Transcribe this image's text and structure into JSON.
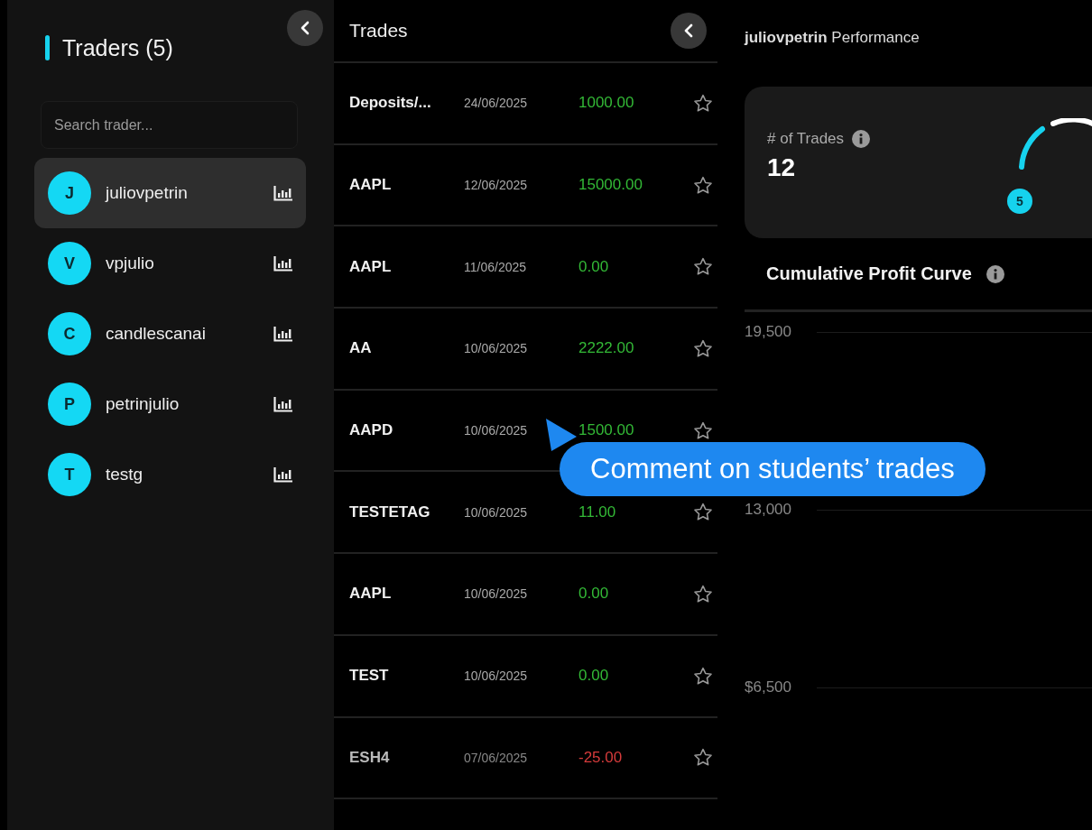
{
  "sidebar": {
    "title": "Traders (5)",
    "search": {
      "placeholder": "Search trader..."
    },
    "traders": [
      {
        "initial": "J",
        "name": "juliovpetrin",
        "selected": true
      },
      {
        "initial": "V",
        "name": "vpjulio",
        "selected": false
      },
      {
        "initial": "C",
        "name": "candlescanai",
        "selected": false
      },
      {
        "initial": "P",
        "name": "petrinjulio",
        "selected": false
      },
      {
        "initial": "T",
        "name": "testg",
        "selected": false
      }
    ]
  },
  "trades": {
    "title": "Trades",
    "rows": [
      {
        "symbol": "Deposits/...",
        "date": "24/06/2025",
        "amount": "1000.00",
        "kind": "profit"
      },
      {
        "symbol": "AAPL",
        "date": "12/06/2025",
        "amount": "15000.00",
        "kind": "profit"
      },
      {
        "symbol": "AAPL",
        "date": "11/06/2025",
        "amount": "0.00",
        "kind": "profit"
      },
      {
        "symbol": "AA",
        "date": "10/06/2025",
        "amount": "2222.00",
        "kind": "profit"
      },
      {
        "symbol": "AAPD",
        "date": "10/06/2025",
        "amount": "1500.00",
        "kind": "profit"
      },
      {
        "symbol": "TESTETAG",
        "date": "10/06/2025",
        "amount": "11.00",
        "kind": "profit"
      },
      {
        "symbol": "AAPL",
        "date": "10/06/2025",
        "amount": "0.00",
        "kind": "profit"
      },
      {
        "symbol": "TEST",
        "date": "10/06/2025",
        "amount": "0.00",
        "kind": "profit"
      },
      {
        "symbol": "ESH4",
        "date": "07/06/2025",
        "amount": "-25.00",
        "kind": "loss"
      }
    ]
  },
  "performance": {
    "title": "**juliovpetrin** Performance",
    "stat": {
      "label": "# of Trades",
      "value": "12",
      "badge": "5"
    },
    "chart": {
      "title": "Cumulative Profit Curve",
      "y_labels": [
        "19,500",
        "13,000",
        "$6,500"
      ]
    }
  },
  "tooltip": {
    "text": "Comment on students’ trades"
  }
}
